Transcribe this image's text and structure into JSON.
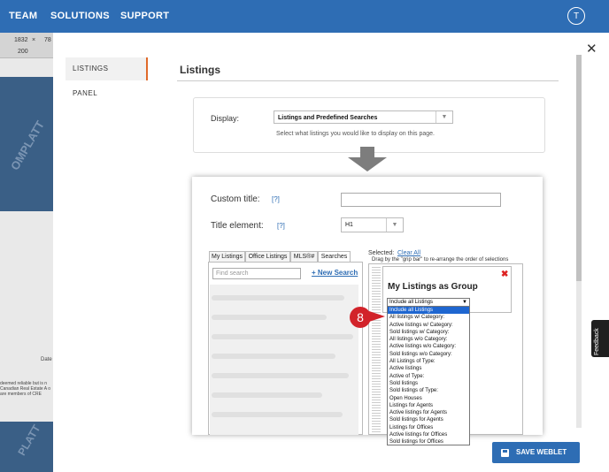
{
  "nav": {
    "team": "TEAM",
    "solutions": "SOLUTIONS",
    "support": "SUPPORT",
    "avatar_initial": "T"
  },
  "background": {
    "ruler": [
      "1832",
      "×",
      "78"
    ],
    "ruler_small": "200",
    "watermark": "OMPLATT",
    "watermark_bottom": "PLATT",
    "date_label": "Date",
    "disclaimer": "deemed reliable but is n Canadian Real Estate A o are members of CRE"
  },
  "modal": {
    "close_icon": "close-icon",
    "sidebar": [
      "LISTINGS",
      "PANEL"
    ],
    "title": "Listings",
    "display_label": "Display:",
    "display_value": "Listings and Predefined Searches",
    "display_help": "Select what listings you would like to display on this page.",
    "custom_title_label": "Custom title:",
    "help_marker": "[?]",
    "title_element_label": "Title element:",
    "title_element_value": "H1",
    "tabs": [
      "My Listings",
      "Office Listings",
      "MLS®#",
      "Searches"
    ],
    "search_placeholder": "Find search",
    "new_search": "+ New Search",
    "selected_label": "Selected:",
    "clear_all": "Clear All",
    "drag_hint": "Drag by the \"grip bar\" to re-arrange the order of selections",
    "group_title": "My Listings as Group",
    "group_remove": "✖",
    "dropdown_value": "Include all Listings",
    "dropdown_options": [
      "Include all Listings",
      "All listings w/ Category:",
      "Active listings w/ Category:",
      "Sold listings w/ Category:",
      "All listings w/o Category:",
      "Active listings w/o Category:",
      "Sold listings w/o Category:",
      "All Listings of Type:",
      "Active listings",
      "Active of Type:",
      "Sold listings",
      "Sold listings of Type:",
      "Open Houses",
      "Listings for Agents",
      "Active listings for Agents",
      "Sold listings for Agents",
      "Listings for Offices",
      "Active listings for Offices",
      "Sold listings for Offices"
    ],
    "step_marker": "8",
    "save_button": "SAVE WEBLET"
  },
  "feedback_tab": "Feedback",
  "colors": {
    "brand": "#2e6db4",
    "accent": "#e06a2a",
    "marker": "#d2232a",
    "highlight": "#1e66d0"
  }
}
